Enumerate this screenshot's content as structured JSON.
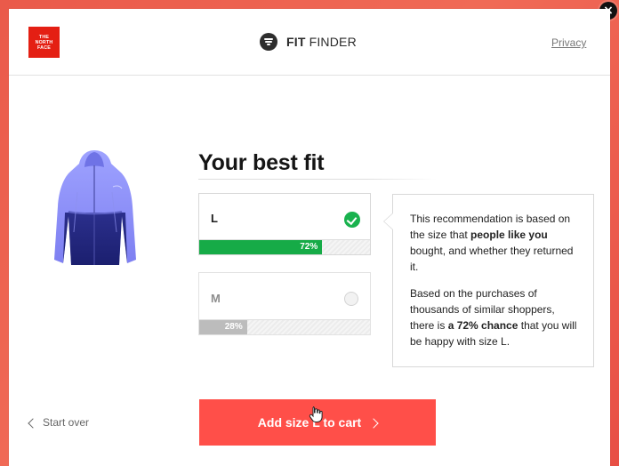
{
  "header": {
    "brand_logo_text": "THE NORTH FACE",
    "app_title_primary": "FIT",
    "app_title_secondary": "FINDER",
    "privacy_link": "Privacy"
  },
  "close": {
    "label": "×"
  },
  "main": {
    "title": "Your best fit",
    "options": [
      {
        "size": "L",
        "percent": 72,
        "percent_label": "72%",
        "selected": true
      },
      {
        "size": "M",
        "percent": 28,
        "percent_label": "28%",
        "selected": false
      }
    ],
    "info": {
      "paragraph_1": {
        "before": "This recommendation is based on the size that ",
        "bold": "people like you",
        "after": " bought, and whether they returned it."
      },
      "paragraph_2": {
        "before": "Based on the purchases of thousands of similar shoppers, there is ",
        "bold": "a 72% chance",
        "after": " that you will be happy with size L."
      }
    }
  },
  "footer": {
    "start_over": "Start over",
    "cta_label": "Add size L to cart"
  },
  "colors": {
    "accent_red": "#ff4f49",
    "success_green": "#16ab47",
    "brand_red": "#e41f13"
  },
  "icons": {
    "close": "close-icon",
    "fit_finder": "fit-finder-icon",
    "check": "check-icon",
    "start_over": "chevron-left-icon",
    "cta": "chevron-right-icon",
    "cursor": "hand-cursor-icon"
  }
}
